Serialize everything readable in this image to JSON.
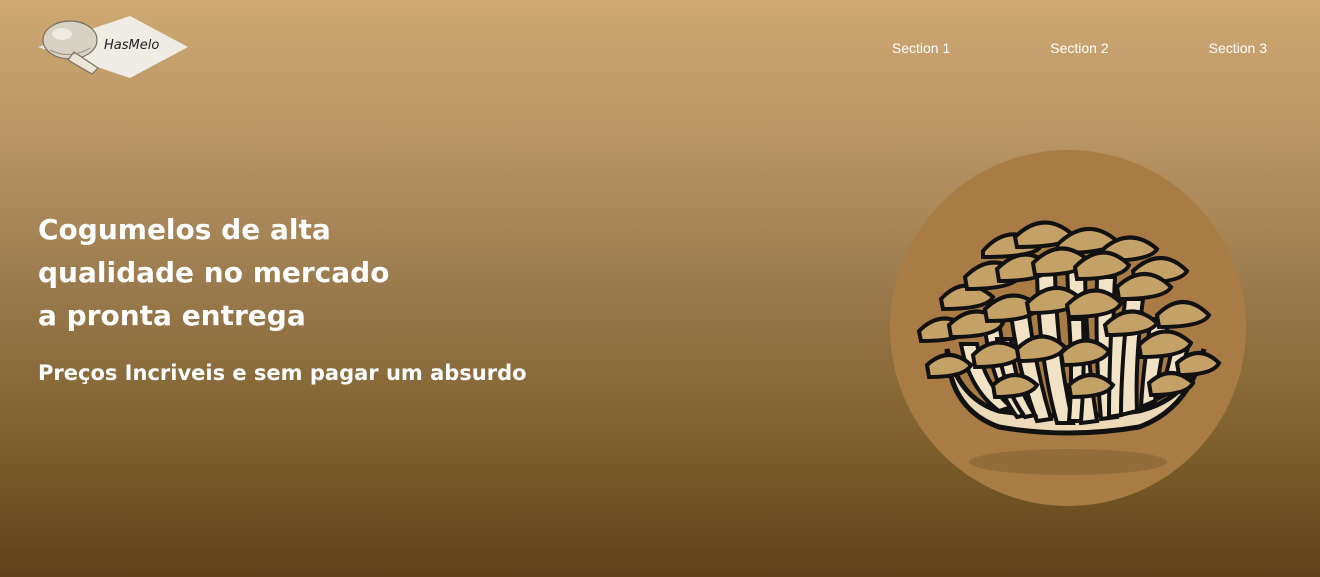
{
  "brand": {
    "logo_text": "HasMelo",
    "icon": "mushroom-icon"
  },
  "nav": {
    "items": [
      {
        "label": "Section 1"
      },
      {
        "label": "Section 2"
      },
      {
        "label": "Section 3"
      }
    ]
  },
  "hero": {
    "title": "Cogumelos de alta qualidade no mercado a pronta entrega",
    "title_lines": [
      "Cogumelos de alta",
      "qualidade no mercado",
      "a pronta entrega"
    ],
    "subtitle": "Preços Incriveis e sem pagar um absurdo"
  },
  "illustration": {
    "icon": "mushroom-cluster-icon"
  },
  "colors": {
    "bg_top": "#cfa872",
    "bg_bottom": "#5e4219",
    "circle": "#a97c45",
    "cap": "#c4a166",
    "stem": "#f0e0c4",
    "text": "#ffffff"
  }
}
